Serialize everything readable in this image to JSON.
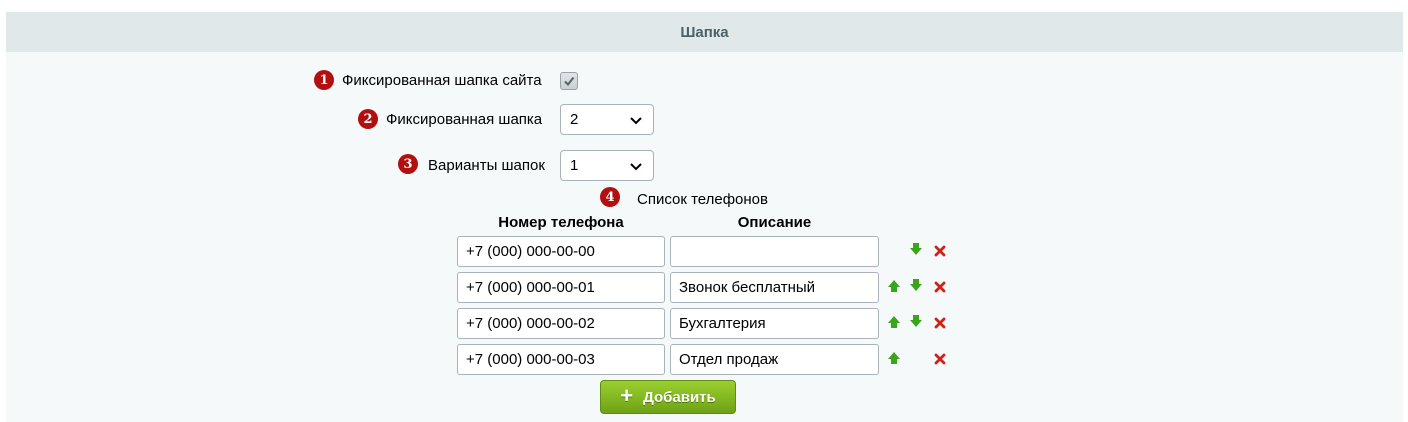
{
  "section": {
    "title": "Шапка"
  },
  "settings": {
    "fixed_header_site": {
      "badge": "1",
      "label": "Фиксированная шапка сайта",
      "checked": true
    },
    "fixed_header": {
      "badge": "2",
      "label": "Фиксированная шапка",
      "value": "2"
    },
    "header_variants": {
      "badge": "3",
      "label": "Варианты шапок",
      "value": "1"
    },
    "phone_list": {
      "badge": "4",
      "label": "Список телефонов"
    }
  },
  "phones": {
    "col_number": "Номер телефона",
    "col_description": "Описание",
    "rows": [
      {
        "number": "+7 (000) 000-00-00",
        "description": "",
        "up": false,
        "down": true
      },
      {
        "number": "+7 (000) 000-00-01",
        "description": "Звонок бесплатный",
        "up": true,
        "down": true
      },
      {
        "number": "+7 (000) 000-00-02",
        "description": "Бухгалтерия",
        "up": true,
        "down": true
      },
      {
        "number": "+7 (000) 000-00-03",
        "description": "Отдел продаж",
        "up": true,
        "down": false
      }
    ],
    "add_label": "Добавить"
  },
  "colors": {
    "badge": "#b21010",
    "header_bg": "#e0e8ea",
    "arrow_green": "#3aa51a",
    "delete_red": "#d0201a",
    "button_green": "#7fb51f"
  }
}
